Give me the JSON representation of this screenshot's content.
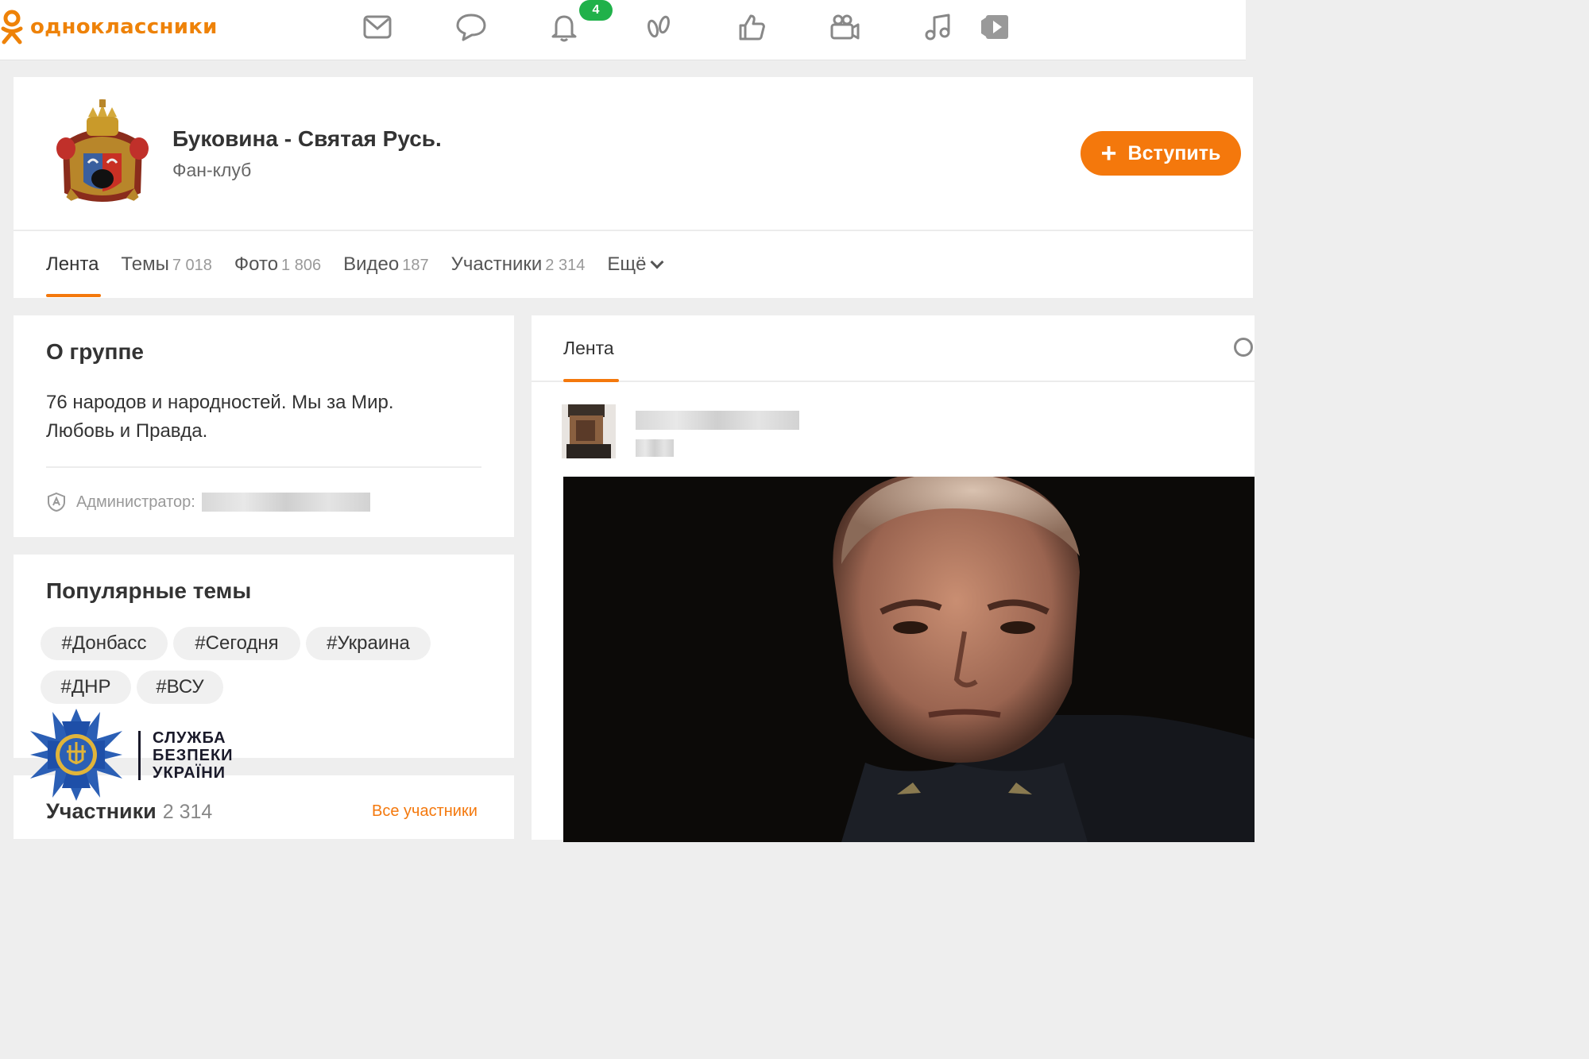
{
  "site": {
    "logo_text": "одноклассники",
    "brand_color": "#ee8208"
  },
  "nav": {
    "icons": [
      "mail-icon",
      "chat-icon",
      "bell-icon",
      "guests-icon",
      "like-icon",
      "video-camera-icon",
      "music-icon",
      "play-icon"
    ],
    "notifications_badge": "4"
  },
  "group": {
    "name": "Буковина - Святая Русь.",
    "type": "Фан-клуб",
    "join_label": "Вступить",
    "tabs": [
      {
        "label": "Лента",
        "count": ""
      },
      {
        "label": "Темы",
        "count": "7 018"
      },
      {
        "label": "Фото",
        "count": "1 806"
      },
      {
        "label": "Видео",
        "count": "187"
      },
      {
        "label": "Участники",
        "count": "2 314"
      },
      {
        "label": "Ещё",
        "count": ""
      }
    ]
  },
  "about": {
    "title": "О группе",
    "text": "76 народов и народностей.  Мы за Мир. Любовь и Правда.",
    "admin_label": "Администратор:"
  },
  "topics": {
    "title": "Популярные темы",
    "tags": [
      "#Донбасс",
      "#Сегодня",
      "#Украина",
      "#ДНР",
      "#ВСУ"
    ]
  },
  "members": {
    "title": "Участники",
    "count": "2 314",
    "all_label": "Все участники"
  },
  "watermark": {
    "line1": "СЛУЖБА",
    "line2": "БЕЗПЕКИ",
    "line3": "УКРАЇНИ"
  },
  "feed": {
    "title": "Лента"
  }
}
